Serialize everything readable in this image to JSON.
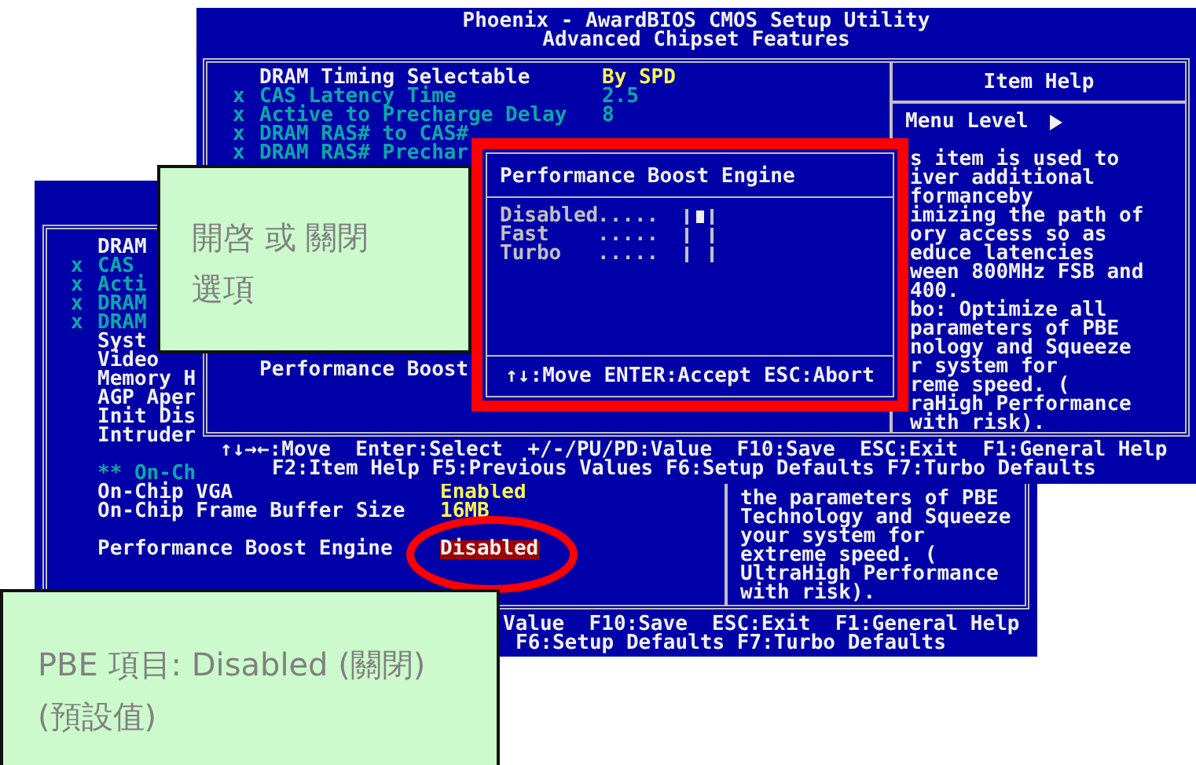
{
  "lower_screen": {
    "groups": [
      {
        "items": [
          {
            "kind": "setting",
            "name": "DRAM",
            "disabled": false
          },
          {
            "kind": "setting",
            "marker": "x",
            "name": "CAS",
            "disabled": true
          },
          {
            "kind": "setting",
            "marker": "x",
            "name": "Acti",
            "disabled": true
          },
          {
            "kind": "setting",
            "marker": "x",
            "name": "DRAM",
            "disabled": true
          },
          {
            "kind": "setting",
            "marker": "x",
            "name": "DRAM",
            "disabled": true
          },
          {
            "kind": "setting",
            "name": "Syst",
            "disabled": false
          },
          {
            "kind": "setting",
            "name": "Video",
            "disabled": false
          },
          {
            "kind": "setting",
            "name": "Memory H",
            "disabled": false
          },
          {
            "kind": "setting",
            "name": "AGP Aper",
            "disabled": false
          },
          {
            "kind": "setting",
            "name": "Init Dis",
            "disabled": false
          },
          {
            "kind": "setting",
            "name": "Intruder",
            "disabled": false
          }
        ]
      },
      {
        "items": [
          {
            "kind": "heading",
            "name": "** On-Ch"
          },
          {
            "kind": "setting",
            "name": "On-Chip VGA",
            "value": "Enabled",
            "disabled": false,
            "highlighted": false
          },
          {
            "kind": "setting",
            "name": "On-Chip Frame Buffer Size",
            "value": "16MB",
            "disabled": false,
            "highlighted": false
          }
        ]
      },
      {
        "items": [
          {
            "kind": "setting",
            "name": "Performance Boost Engine",
            "value": "Disabled",
            "disabled": false,
            "highlighted": true
          }
        ]
      }
    ],
    "help_lines": [
      "the parameters of PBE",
      "Technology and Squeeze",
      "your system for",
      "extreme speed. (",
      "UltraHigh Performance",
      "with risk)."
    ],
    "footer": [
      "Value  F10:Save  ESC:Exit  F1:General Help",
      "F6:Setup Defaults F7:Turbo Defaults"
    ]
  },
  "upper_screen": {
    "title": [
      "Phoenix - AwardBIOS CMOS Setup Utility",
      "Advanced Chipset Features"
    ],
    "groups": [
      {
        "items": [
          {
            "kind": "setting",
            "name": "DRAM Timing Selectable",
            "value": "By SPD",
            "disabled": false,
            "highlighted": false
          },
          {
            "kind": "setting",
            "marker": "x",
            "name": "CAS Latency Time",
            "value": "2.5",
            "disabled": true,
            "highlighted": false
          },
          {
            "kind": "setting",
            "marker": "x",
            "name": "Active to Precharge Delay",
            "value": "8",
            "disabled": true,
            "highlighted": false
          },
          {
            "kind": "setting",
            "marker": "x",
            "name": "DRAM RAS# to CAS#",
            "disabled": true
          },
          {
            "kind": "setting",
            "marker": "x",
            "name": "DRAM RAS# Prechar",
            "disabled": true
          }
        ]
      },
      {
        "items": [
          {
            "kind": "setting",
            "name": "Performance Boost",
            "disabled": false
          }
        ]
      }
    ],
    "help_title": "Item Help",
    "menu_level": "Menu Level",
    "help_lines": [
      "s item is used to",
      "iver additional",
      "formanceby",
      "imizing the path of",
      "ory access so as",
      "educe latencies",
      "ween 800MHz FSB and",
      "400.",
      "bo: Optimize all",
      "parameters of PBE",
      "nology and Squeeze",
      "r system for",
      "reme speed. (",
      "raHigh Performance",
      "with risk)."
    ],
    "footer": [
      "↑↓→←:Move  Enter:Select  +/-/PU/PD:Value  F10:Save  ESC:Exit  F1:General Help",
      "F2:Item Help F5:Previous Values F6:Setup Defaults F7:Turbo Defaults"
    ]
  },
  "popup": {
    "title": "Performance Boost Engine",
    "options": [
      {
        "label": "Disabled",
        "leader": ".....",
        "selected": true
      },
      {
        "label": "Fast",
        "leader": ".....",
        "selected": false
      },
      {
        "label": "Turbo",
        "leader": ".....",
        "selected": false
      }
    ],
    "footer": "↑↓:Move ENTER:Accept ESC:Abort"
  },
  "callouts": [
    {
      "lines": [
        "開啓 或 關閉",
        "選項"
      ]
    },
    {
      "lines": [
        "PBE 項目: Disabled (關閉)",
        "(預設值)"
      ]
    }
  ]
}
